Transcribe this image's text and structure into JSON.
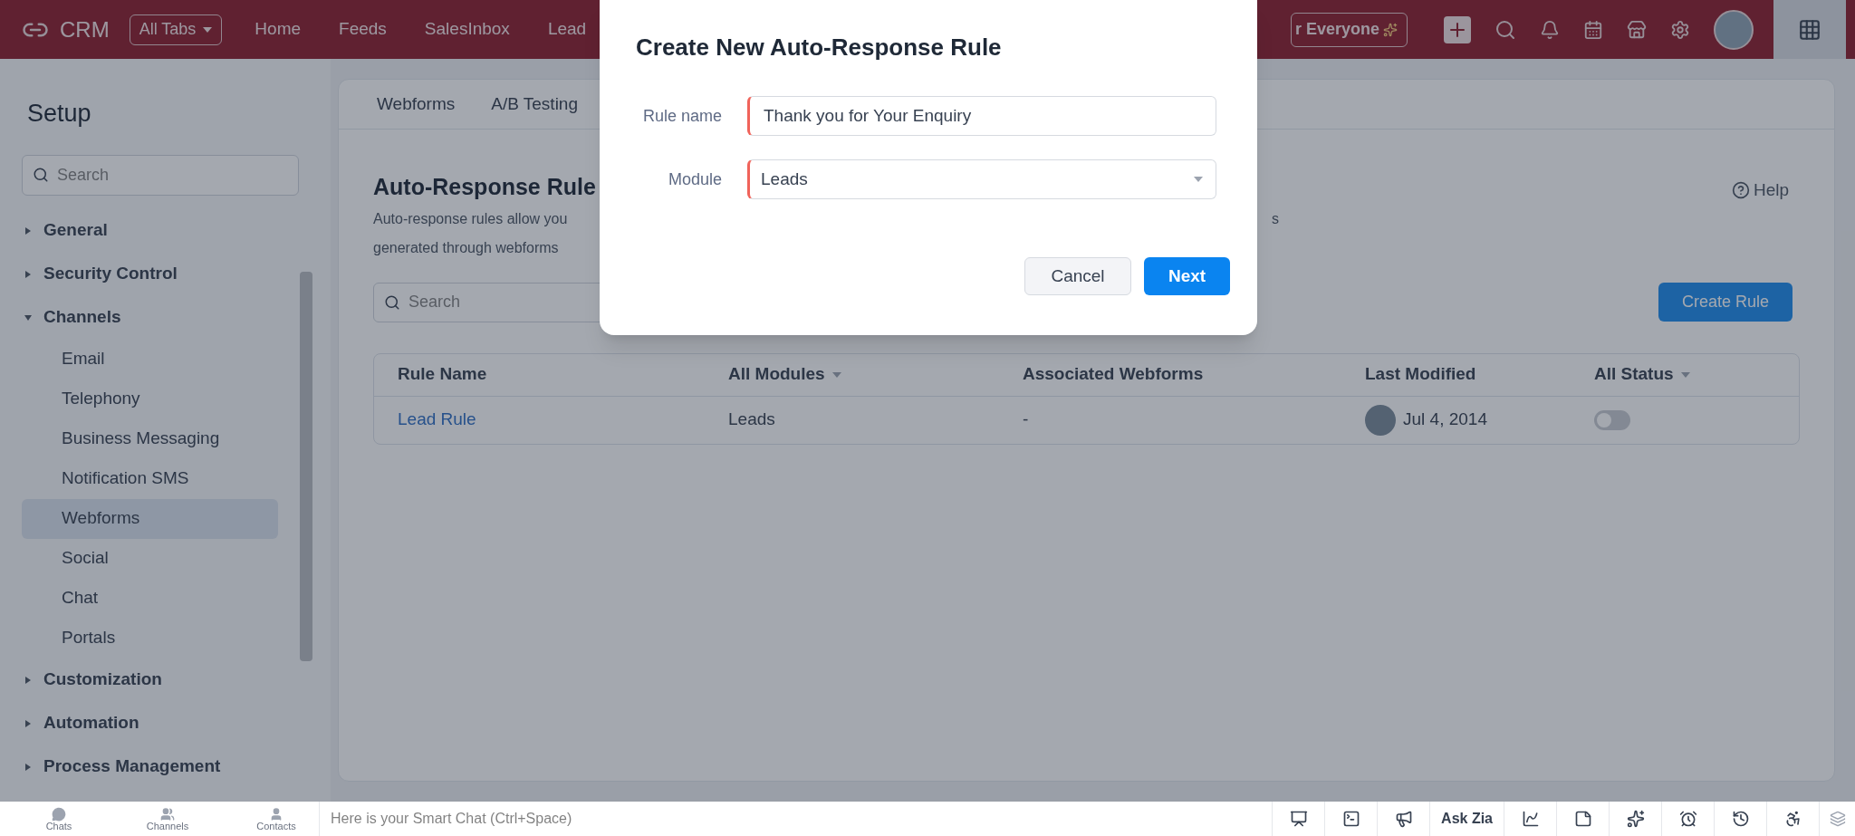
{
  "top_bar": {
    "logo": "CRM",
    "all_tabs": "All Tabs",
    "nav": [
      "Home",
      "Feeds",
      "SalesInbox",
      "Lead"
    ],
    "promo_button": "r Everyone"
  },
  "sidebar": {
    "title": "Setup",
    "search": {
      "placeholder": "Search"
    },
    "items": [
      {
        "label": "General",
        "expanded": false
      },
      {
        "label": "Security Control",
        "expanded": false
      },
      {
        "label": "Channels",
        "expanded": true,
        "children": [
          {
            "label": "Email",
            "selected": false
          },
          {
            "label": "Telephony",
            "selected": false
          },
          {
            "label": "Business Messaging",
            "selected": false
          },
          {
            "label": "Notification SMS",
            "selected": false
          },
          {
            "label": "Webforms",
            "selected": true
          },
          {
            "label": "Social",
            "selected": false
          },
          {
            "label": "Chat",
            "selected": false
          },
          {
            "label": "Portals",
            "selected": false
          }
        ]
      },
      {
        "label": "Customization",
        "expanded": false
      },
      {
        "label": "Automation",
        "expanded": false
      },
      {
        "label": "Process Management",
        "expanded": false
      }
    ]
  },
  "main": {
    "tabs": [
      "Webforms",
      "A/B Testing"
    ],
    "heading": "Auto-Response Rule",
    "description": [
      "Auto-response rules allow you",
      "generated through webforms"
    ],
    "description_tail": "s",
    "help": "Help",
    "search": {
      "placeholder": "Search"
    },
    "create_button": "Create Rule",
    "table": {
      "columns": [
        {
          "label": "Rule Name",
          "kind": "plain"
        },
        {
          "label": "All Modules",
          "kind": "filter"
        },
        {
          "label": "Associated Webforms",
          "kind": "plain"
        },
        {
          "label": "Last Modified",
          "kind": "plain"
        },
        {
          "label": "All Status",
          "kind": "filter"
        }
      ],
      "rows": [
        {
          "rule_name": "Lead Rule",
          "module": "Leads",
          "webforms": "-",
          "last_modified": "Jul 4, 2014",
          "active": false
        }
      ]
    }
  },
  "dialog": {
    "title": "Create New Auto-Response Rule",
    "fields": [
      {
        "label": "Rule name",
        "kind": "text",
        "value": "Thank you for Your Enquiry"
      },
      {
        "label": "Module",
        "kind": "select",
        "value": "Leads"
      }
    ],
    "cancel": "Cancel",
    "next": "Next"
  },
  "bottom_bar": {
    "tabs": [
      "Chats",
      "Channels",
      "Contacts"
    ],
    "chat": {
      "placeholder": "Here is your Smart Chat (Ctrl+Space)"
    },
    "ask_zia": "Ask Zia"
  }
}
